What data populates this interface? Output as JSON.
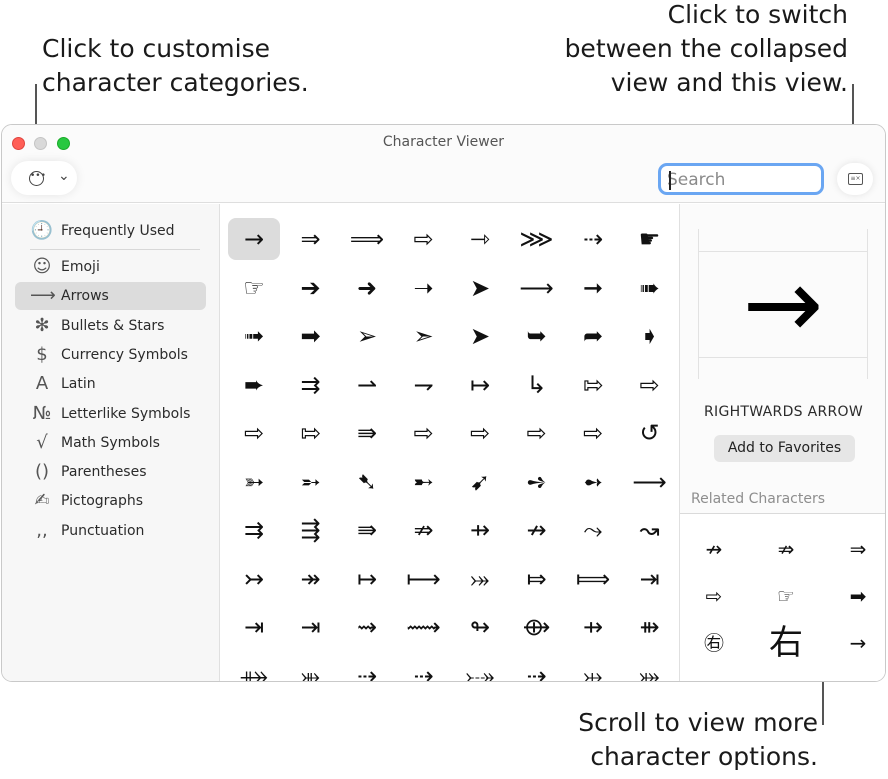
{
  "callouts": {
    "customise": [
      "Click to customise",
      "character categories."
    ],
    "switch_view": [
      "Click to switch",
      "between the collapsed",
      "view and this view."
    ],
    "scroll": [
      "Scroll to view more",
      "character options."
    ]
  },
  "window": {
    "title": "Character Viewer"
  },
  "toolbar": {
    "customise_icon": "ellipsis-circle-icon",
    "chevron_icon": "chevron-down-icon",
    "search_placeholder": "Search",
    "search_value": "",
    "view_toggle_icon": "collapse-view-icon"
  },
  "sidebar": {
    "items": [
      {
        "icon": "🕘",
        "icon_name": "clock-icon",
        "label": "Frequently Used"
      },
      {
        "icon": "☺",
        "icon_name": "emoji-icon",
        "label": "Emoji"
      },
      {
        "icon": "⟶",
        "icon_name": "arrow-icon",
        "label": "Arrows",
        "selected": true
      },
      {
        "icon": "✻",
        "icon_name": "asterisk-icon",
        "label": "Bullets & Stars"
      },
      {
        "icon": "$",
        "icon_name": "dollar-icon",
        "label": "Currency Symbols"
      },
      {
        "icon": "A",
        "icon_name": "latin-letter-icon",
        "label": "Latin"
      },
      {
        "icon": "№",
        "icon_name": "numero-icon",
        "label": "Letterlike Symbols"
      },
      {
        "icon": "√",
        "icon_name": "square-root-icon",
        "label": "Math Symbols"
      },
      {
        "icon": "()",
        "icon_name": "parentheses-icon",
        "label": "Parentheses"
      },
      {
        "icon": "✍",
        "icon_name": "pictograph-icon",
        "label": "Pictographs"
      },
      {
        "icon": ",,",
        "icon_name": "punctuation-icon",
        "label": "Punctuation"
      }
    ]
  },
  "grid": {
    "rows": [
      [
        "→",
        "⇒",
        "⟹",
        "⇨",
        "⇾",
        "⋙",
        "⇢",
        "☛"
      ],
      [
        "☞",
        "➔",
        "➜",
        "➝",
        "➤",
        "⟶",
        "➞",
        "➠"
      ],
      [
        "➟",
        "➡",
        "➢",
        "➣",
        "➤",
        "➥",
        "➦",
        "➧"
      ],
      [
        "➨",
        "⇉",
        "⇀",
        "⇁",
        "↦",
        "↳",
        "⇰",
        "⇨"
      ],
      [
        "⇨",
        "⇰",
        "⇛",
        "⇨",
        "⇨",
        "⇨",
        "⇨",
        "↺"
      ],
      [
        "➳",
        "➵",
        "➷",
        "➸",
        "➹",
        "➺",
        "➻",
        "⟶"
      ],
      [
        "⇉",
        "⇶",
        "⇛",
        "⇏",
        "⇸",
        "↛",
        "⤳",
        "↝"
      ],
      [
        "↣",
        "↠",
        "↦",
        "⟼",
        "⤖",
        "⤇",
        "⟾",
        "⇥"
      ],
      [
        "⇥",
        "⇥",
        "⇝",
        "⟿",
        "↬",
        "⟴",
        "⇸",
        "⇻"
      ],
      [
        "⤁",
        "⤕",
        "⇢",
        "⇢",
        "⤐",
        "⇢",
        "⤔",
        "⤗"
      ]
    ],
    "selected": [
      0,
      0
    ]
  },
  "info": {
    "glyph": "→",
    "name": "RIGHTWARDS ARROW",
    "favorites_label": "Add to Favorites",
    "related_heading": "Related Characters",
    "related": [
      "↛",
      "⇏",
      "⇒",
      "⇨",
      "☞",
      "➡",
      "㊨",
      "右",
      "→"
    ]
  }
}
